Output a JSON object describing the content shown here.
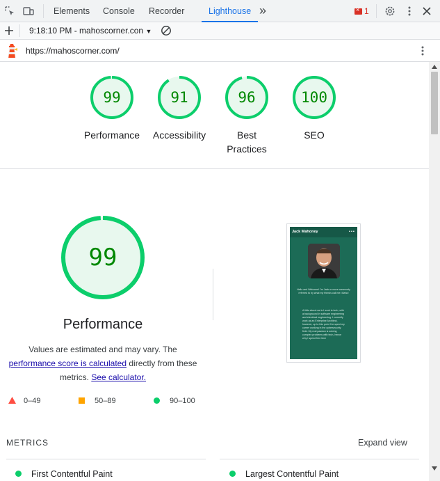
{
  "devtools": {
    "tabs": [
      {
        "label": "Elements"
      },
      {
        "label": "Console"
      },
      {
        "label": "Recorder"
      },
      {
        "label": "Lighthouse"
      }
    ],
    "more_tabs": "»",
    "error_count": "1"
  },
  "report_bar": {
    "timestamp": "9:18:10 PM - mahoscorner.con"
  },
  "url_bar": {
    "url": "https://mahoscorner.com/"
  },
  "scores": [
    {
      "value": "99",
      "label": "Performance",
      "score": 99
    },
    {
      "value": "91",
      "label": "Accessibility",
      "score": 91
    },
    {
      "value": "96",
      "label": "Best Practices",
      "score": 96
    },
    {
      "value": "100",
      "label": "SEO",
      "score": 100
    }
  ],
  "performance": {
    "score_value": "99",
    "score": 99,
    "title": "Performance",
    "desc_1": "Values are estimated and may vary. The",
    "desc_link_1": "performance score is calculated",
    "desc_2": "directly from these metrics.",
    "desc_link_2": "See calculator."
  },
  "legend": [
    {
      "label": "0–49"
    },
    {
      "label": "50–89"
    },
    {
      "label": "90–100"
    }
  ],
  "metrics": {
    "heading": "METRICS",
    "expand_label": "Expand view",
    "items": [
      {
        "label": "First Contentful Paint"
      },
      {
        "label": "Largest Contentful Paint"
      }
    ]
  },
  "screenshot": {
    "site_name": "Jack Mahoney",
    "intro": "Hello and Welcome! I'm Jack or more commonly referred to by what my friends call me: Maho!",
    "bio": "A little about me is I work in tech, with a background in software engineering and electrical engineering. I currently work as an Enterprise Architect, however, up to this point I've spent my career working in the cybersecurity field. My real passion is solving complex problems with tech, hence why I spend free time"
  },
  "colors": {
    "pass_green": "#0cce6b",
    "pass_text": "#008800",
    "pass_fill": "#e8f8ee",
    "average_orange": "#ffa400",
    "fail_red": "#ff4e42",
    "accent_blue": "#1a73e8"
  }
}
